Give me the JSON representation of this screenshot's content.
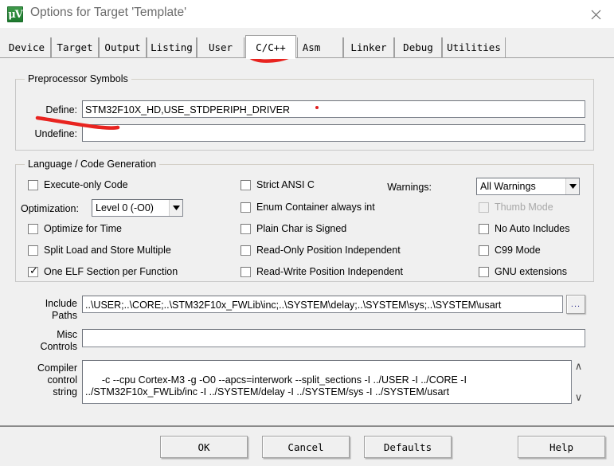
{
  "window": {
    "title": "Options for Target 'Template'",
    "icon": "keil-uvision-icon",
    "close_label": "✕"
  },
  "tabs": [
    {
      "label": "Device",
      "active": false
    },
    {
      "label": "Target",
      "active": false
    },
    {
      "label": "Output",
      "active": false
    },
    {
      "label": "Listing",
      "active": false
    },
    {
      "label": "User",
      "active": false
    },
    {
      "label": "C/C++",
      "active": true
    },
    {
      "label": "Asm",
      "active": false
    },
    {
      "label": "Linker",
      "active": false
    },
    {
      "label": "Debug",
      "active": false
    },
    {
      "label": "Utilities",
      "active": false
    }
  ],
  "preprocessor": {
    "group_title": "Preprocessor Symbols",
    "define_label": "Define:",
    "define_value": "STM32F10X_HD,USE_STDPERIPH_DRIVER",
    "undefine_label": "Undefine:",
    "undefine_value": ""
  },
  "language": {
    "group_title": "Language / Code Generation",
    "col1": [
      {
        "label": "Execute-only Code",
        "checked": false,
        "disabled": false
      },
      {
        "label": "Optimize for Time",
        "checked": false,
        "disabled": false
      },
      {
        "label": "Split Load and Store Multiple",
        "checked": false,
        "disabled": false
      },
      {
        "label": "One ELF Section per Function",
        "checked": true,
        "disabled": false
      }
    ],
    "col2": [
      {
        "label": "Strict ANSI C",
        "checked": false,
        "disabled": false
      },
      {
        "label": "Enum Container always int",
        "checked": false,
        "disabled": false
      },
      {
        "label": "Plain Char is Signed",
        "checked": false,
        "disabled": false
      },
      {
        "label": "Read-Only Position Independent",
        "checked": false,
        "disabled": false
      },
      {
        "label": "Read-Write Position Independent",
        "checked": false,
        "disabled": false
      }
    ],
    "col3": [
      {
        "label": "Thumb Mode",
        "checked": false,
        "disabled": true
      },
      {
        "label": "No Auto Includes",
        "checked": false,
        "disabled": false
      },
      {
        "label": "C99 Mode",
        "checked": false,
        "disabled": false
      },
      {
        "label": "GNU extensions",
        "checked": false,
        "disabled": false
      }
    ],
    "optimization_label": "Optimization:",
    "optimization_value": "Level 0 (-O0)",
    "warnings_label": "Warnings:",
    "warnings_value": "All Warnings"
  },
  "paths": {
    "include_label_line1": "Include",
    "include_label_line2": "Paths",
    "include_value": "..\\USER;..\\CORE;..\\STM32F10x_FWLib\\inc;..\\SYSTEM\\delay;..\\SYSTEM\\sys;..\\SYSTEM\\usart",
    "browse_label": "...",
    "misc_label_line1": "Misc",
    "misc_label_line2": "Controls",
    "misc_value": "",
    "compiler_label_line1": "Compiler",
    "compiler_label_line2": "control",
    "compiler_label_line3": "string",
    "compiler_value": "-c --cpu Cortex-M3 -g -O0 --apcs=interwork --split_sections -I ../USER -I ../CORE -I ../STM32F10x_FWLib/inc -I ../SYSTEM/delay -I ../SYSTEM/sys -I ../SYSTEM/usart",
    "scroll_up": "∧",
    "scroll_down": "∨"
  },
  "buttons": {
    "ok": "OK",
    "cancel": "Cancel",
    "defaults": "Defaults",
    "help": "Help"
  },
  "annotations": {
    "accent_color": "#e8231f",
    "marks": [
      "underline-cpp-tab",
      "underline-define-label",
      "red-dot-after-define"
    ]
  }
}
